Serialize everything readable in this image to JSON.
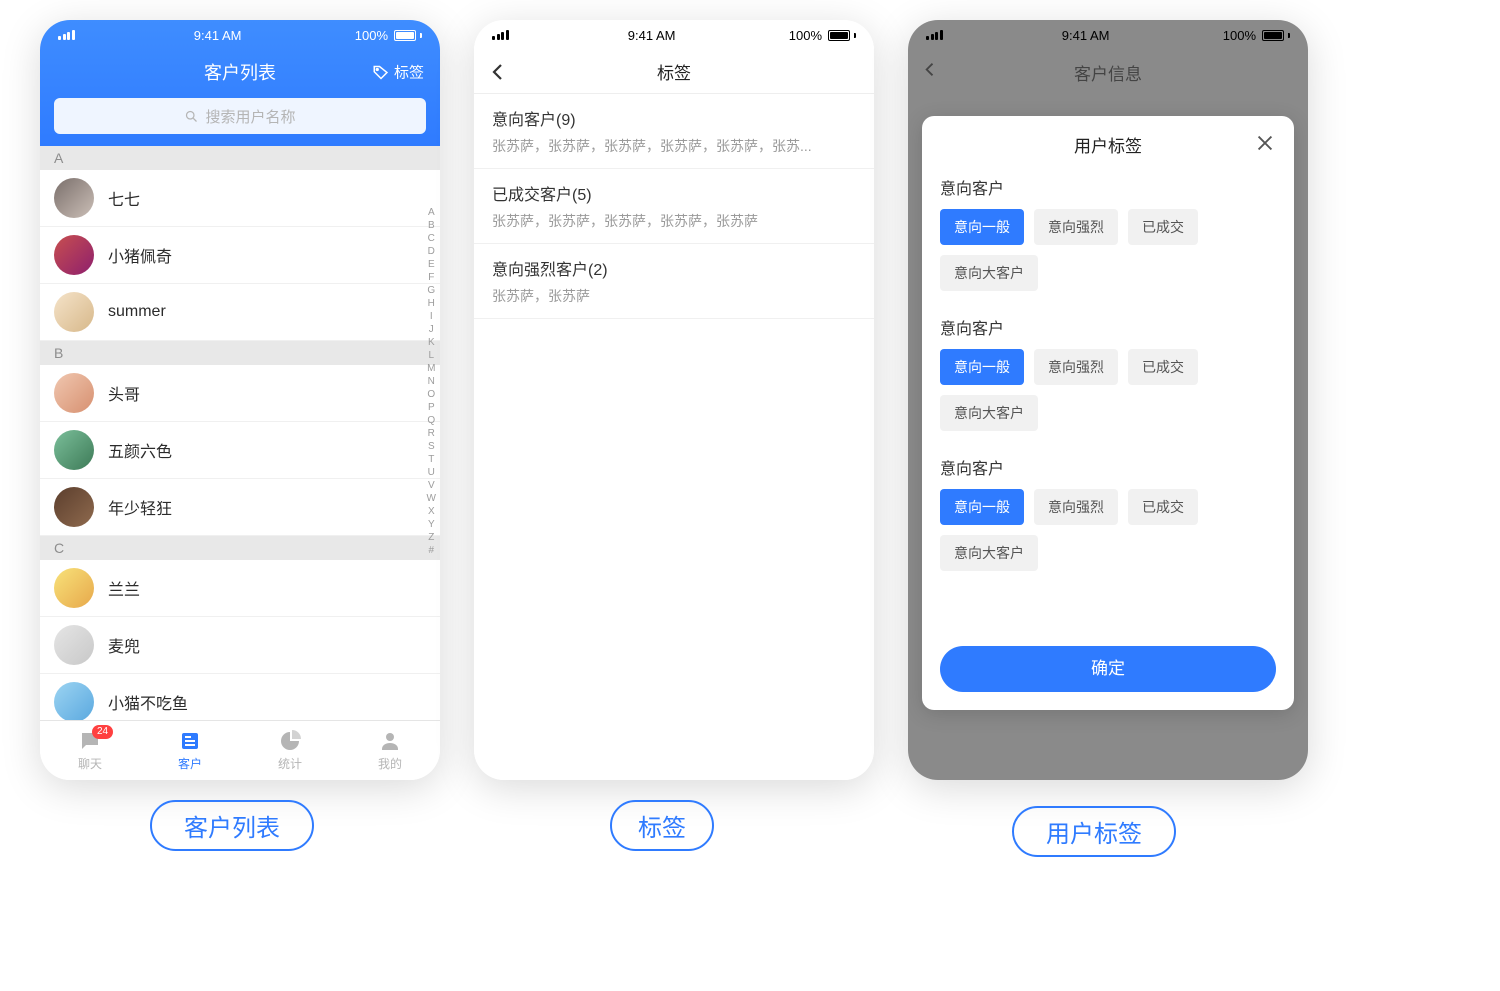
{
  "status": {
    "time": "9:41 AM",
    "battery": "100%"
  },
  "phone1": {
    "title": "客户列表",
    "tag_btn": "标签",
    "search_placeholder": "搜索用户名称",
    "sections": [
      {
        "letter": "A",
        "contacts": [
          "七七",
          "小猪佩奇",
          "summer"
        ]
      },
      {
        "letter": "B",
        "contacts": [
          "头哥",
          "五颜六色",
          "年少轻狂"
        ]
      },
      {
        "letter": "C",
        "contacts": [
          "兰兰",
          "麦兜",
          "小猫不吃鱼"
        ]
      }
    ],
    "index": [
      "A",
      "B",
      "C",
      "D",
      "E",
      "F",
      "G",
      "H",
      "I",
      "J",
      "K",
      "L",
      "M",
      "N",
      "O",
      "P",
      "Q",
      "R",
      "S",
      "T",
      "U",
      "V",
      "W",
      "X",
      "Y",
      "Z",
      "#"
    ],
    "tabs": [
      {
        "label": "聊天",
        "badge": "24"
      },
      {
        "label": "客户",
        "active": true
      },
      {
        "label": "统计"
      },
      {
        "label": "我的"
      }
    ]
  },
  "phone2": {
    "title": "标签",
    "sections": [
      {
        "title": "意向客户(9)",
        "sub": "张苏萨，张苏萨，张苏萨，张苏萨，张苏萨，张苏..."
      },
      {
        "title": "已成交客户(5)",
        "sub": "张苏萨，张苏萨，张苏萨，张苏萨，张苏萨"
      },
      {
        "title": "意向强烈客户(2)",
        "sub": "张苏萨，张苏萨"
      }
    ]
  },
  "phone3": {
    "nav_title": "客户信息",
    "sheet_title": "用户标签",
    "groups": [
      {
        "title": "意向客户",
        "chips": [
          {
            "t": "意向一般",
            "sel": true
          },
          {
            "t": "意向强烈"
          },
          {
            "t": "已成交"
          },
          {
            "t": "意向大客户"
          }
        ]
      },
      {
        "title": "意向客户",
        "chips": [
          {
            "t": "意向一般",
            "sel": true
          },
          {
            "t": "意向强烈"
          },
          {
            "t": "已成交"
          },
          {
            "t": "意向大客户"
          }
        ]
      },
      {
        "title": "意向客户",
        "chips": [
          {
            "t": "意向一般",
            "sel": true
          },
          {
            "t": "意向强烈"
          },
          {
            "t": "已成交"
          },
          {
            "t": "意向大客户"
          }
        ]
      }
    ],
    "confirm": "确定"
  },
  "labels": {
    "p1": "客户列表",
    "p2": "标签",
    "p3": "用户标签"
  }
}
